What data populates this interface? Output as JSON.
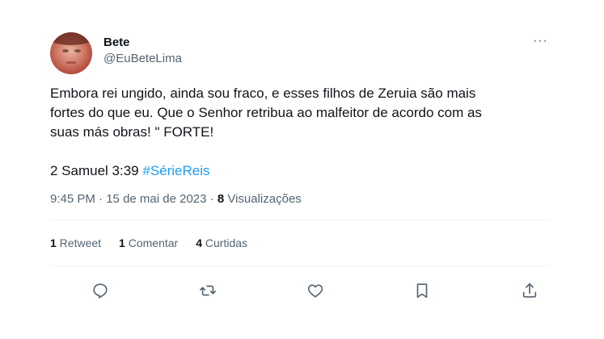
{
  "tweet": {
    "display_name": "Bete",
    "handle": "@EuBeteLima",
    "more_label": "···",
    "text_lines": [
      "Embora rei ungido, ainda sou fraco, e esses filhos de Zeruia são mais",
      "fortes do que eu. Que o Senhor retribua ao malfeitor de acordo com as",
      "suas más obras! \" FORTE!"
    ],
    "reference": "2 Samuel 3:39 ",
    "hashtag": "#SérieReis",
    "time": "9:45 PM",
    "separator": " · ",
    "date": "15 de mai de 2023",
    "views_count": "8",
    "views_label": " Visualizações"
  },
  "stats": {
    "retweets_count": "1",
    "retweets_label": " Retweet",
    "comments_count": "1",
    "comments_label": " Comentar",
    "likes_count": "4",
    "likes_label": " Curtidas"
  },
  "icons": {
    "reply": "reply-icon",
    "retweet": "retweet-icon",
    "like": "like-icon",
    "bookmark": "bookmark-icon",
    "share": "share-icon"
  },
  "colors": {
    "link": "#1d9bf0",
    "secondary_text": "#536471",
    "primary_text": "#0f1419"
  }
}
